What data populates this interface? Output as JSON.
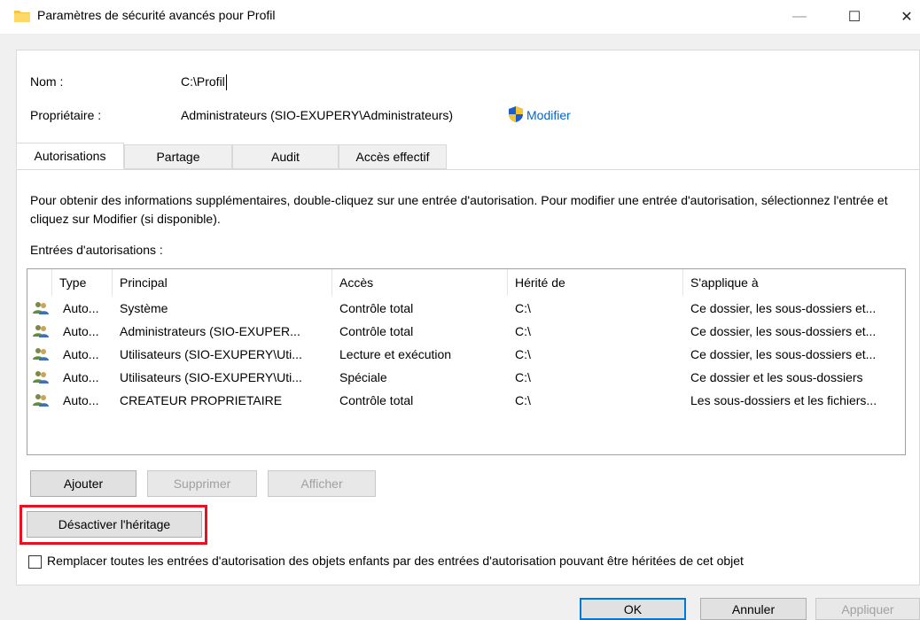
{
  "window": {
    "title": "Paramètres de sécurité avancés pour Profil",
    "min_glyph": "—",
    "max_glyph": "☐",
    "close_glyph": "✕"
  },
  "fields": {
    "name_label": "Nom :",
    "name_value": "C:\\Profil",
    "owner_label": "Propriétaire :",
    "owner_value": "Administrateurs (SIO-EXUPERY\\Administrateurs)",
    "modify_link": "Modifier"
  },
  "tabs": [
    {
      "label": "Autorisations",
      "active": true
    },
    {
      "label": "Partage",
      "active": false
    },
    {
      "label": "Audit",
      "active": false
    },
    {
      "label": "Accès effectif",
      "active": false
    }
  ],
  "description": "Pour obtenir des informations supplémentaires, double-cliquez sur une entrée d'autorisation. Pour modifier une entrée d'autorisation, sélectionnez l'entrée et cliquez sur Modifier (si disponible).",
  "entries_label": "Entrées d'autorisations :",
  "table": {
    "columns": [
      "Type",
      "Principal",
      "Accès",
      "Hérité de",
      "S'applique à"
    ],
    "rows": [
      [
        "Auto...",
        "Système",
        "Contrôle total",
        "C:\\",
        "Ce dossier, les sous-dossiers et..."
      ],
      [
        "Auto...",
        "Administrateurs (SIO-EXUPER...",
        "Contrôle total",
        "C:\\",
        "Ce dossier, les sous-dossiers et..."
      ],
      [
        "Auto...",
        "Utilisateurs (SIO-EXUPERY\\Uti...",
        "Lecture et exécution",
        "C:\\",
        "Ce dossier, les sous-dossiers et..."
      ],
      [
        "Auto...",
        "Utilisateurs (SIO-EXUPERY\\Uti...",
        "Spéciale",
        "C:\\",
        "Ce dossier et les sous-dossiers"
      ],
      [
        "Auto...",
        "CREATEUR PROPRIETAIRE",
        "Contrôle total",
        "C:\\",
        "Les sous-dossiers et les fichiers..."
      ]
    ]
  },
  "buttons": {
    "add": "Ajouter",
    "remove": "Supprimer",
    "view": "Afficher",
    "disable_inheritance": "Désactiver l'héritage",
    "ok": "OK",
    "cancel": "Annuler",
    "apply": "Appliquer"
  },
  "replace_checkbox_label": "Remplacer toutes les entrées d'autorisation des objets enfants par des entrées d'autorisation pouvant être héritées de cet objet",
  "colors": {
    "highlight": "#e81123",
    "link": "#0066cc",
    "primary_border": "#0078d7"
  }
}
